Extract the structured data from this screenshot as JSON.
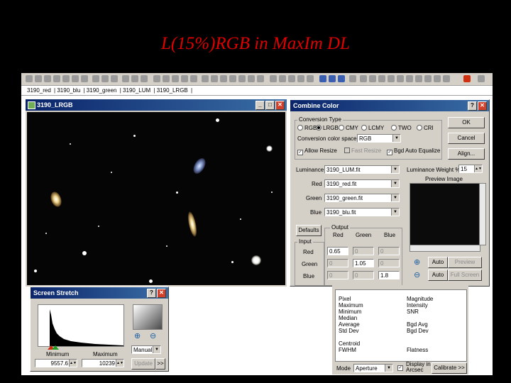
{
  "slide": {
    "title": "L(15%)RGB in MaxIm DL"
  },
  "tabs": [
    "3190_red",
    "3190_blu",
    "3190_green",
    "3190_LUM",
    "3190_LRGB"
  ],
  "image_window": {
    "title": "3190_LRGB"
  },
  "combine_color": {
    "title": "Combine Color",
    "conversion_type_label": "Conversion Type",
    "types": [
      "RGB",
      "LRGB",
      "CMY",
      "LCMY",
      "TWO",
      "CRI"
    ],
    "selected_type": "LRGB",
    "color_space_label": "Conversion color space",
    "color_space_value": "RGB",
    "allow_resize": "Allow Resize",
    "fast_resize": "Fast Resize",
    "bgd_auto_equalize": "Bgd Auto Equalize",
    "ok": "OK",
    "cancel": "Cancel",
    "align": "Align...",
    "channels": [
      {
        "label": "Luminance",
        "file": "3190_LUM.fit"
      },
      {
        "label": "Red",
        "file": "3190_red.fit"
      },
      {
        "label": "Green",
        "file": "3190_green.fit"
      },
      {
        "label": "Blue",
        "file": "3190_blu.fit"
      }
    ],
    "luminance_weight_label": "Luminance Weight %",
    "luminance_weight_value": "15",
    "preview_image_label": "Preview Image",
    "defaults": "Defaults",
    "output_label": "Output",
    "input_label": "Input",
    "col_headers": [
      "Red",
      "Green",
      "Blue"
    ],
    "rows": [
      {
        "label": "Red",
        "values": [
          "0.65",
          "0",
          "0"
        ]
      },
      {
        "label": "Green",
        "values": [
          "0",
          "1.05",
          "0"
        ]
      },
      {
        "label": "Blue",
        "values": [
          "0",
          "0",
          "1.8"
        ]
      }
    ],
    "auto1": "Auto",
    "preview_btn": "Preview",
    "auto2": "Auto",
    "full_screen": "Full Screen"
  },
  "screen_stretch": {
    "title": "Screen Stretch",
    "minimum_label": "Minimum",
    "maximum_label": "Maximum",
    "minimum_value": "9557.6",
    "maximum_value": "10239",
    "mode_value": "Manual",
    "update": "Update",
    "more": ">>"
  },
  "info_panel": {
    "left_labels": [
      "Pixel",
      "Maximum",
      "Minimum",
      "Median",
      "Average",
      "Std Dev",
      "",
      "Centroid",
      "FWHM"
    ],
    "right_labels": [
      "Magnitude",
      "Intensity",
      "SNR",
      "",
      "Bgd Avg",
      "Bgd Dev",
      "",
      "",
      "Flatness"
    ],
    "mode_label": "Mode",
    "mode_value": "Aperture",
    "display_in_arcsec_line1": "Display in",
    "display_in_arcsec_line2": "Arcsec",
    "calibrate": "Calibrate >>"
  }
}
